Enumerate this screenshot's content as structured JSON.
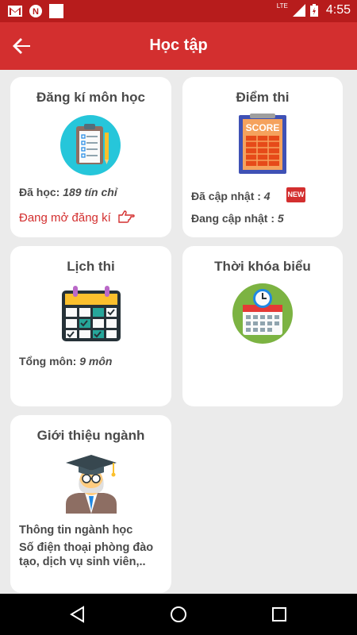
{
  "status": {
    "time": "4:55",
    "network_label": "LTE",
    "icons": [
      "gmail-icon",
      "notification-n-icon",
      "blank-app-icon",
      "signal-icon",
      "battery-icon"
    ]
  },
  "appbar": {
    "title": "Học tập",
    "back_icon": "arrow-left-icon"
  },
  "cards": {
    "registration": {
      "title": "Đăng kí môn học",
      "studied_label": "Đã học:",
      "studied_value": "189 tín chỉ",
      "open_status": "Đang mở đăng kí",
      "icon": "clipboard-checklist-icon"
    },
    "scores": {
      "title": "Điểm thi",
      "updated_label": "Đã cập nhật :",
      "updated_value": "4",
      "new_badge": "NEW",
      "updating_label": "Đang cập nhật :",
      "updating_value": "5",
      "icon": "score-board-icon",
      "icon_text": "SCORE"
    },
    "exam": {
      "title": "Lịch thi",
      "total_label": "Tổng môn:",
      "total_value": "9 môn",
      "icon": "calendar-check-icon"
    },
    "timetable": {
      "title": "Thời khóa biểu",
      "icon": "calendar-clock-icon"
    },
    "major": {
      "title": "Giới thiệu ngành",
      "line1": "Thông tin ngành học",
      "line2": "Số điện thoại phòng đào",
      "line3": "tạo, dịch vụ sinh viên,..",
      "icon": "professor-icon"
    }
  },
  "colors": {
    "primary": "#d32f2f",
    "statusbar": "#b71c1c",
    "background": "#ebebeb",
    "text": "#4a4a4a"
  }
}
